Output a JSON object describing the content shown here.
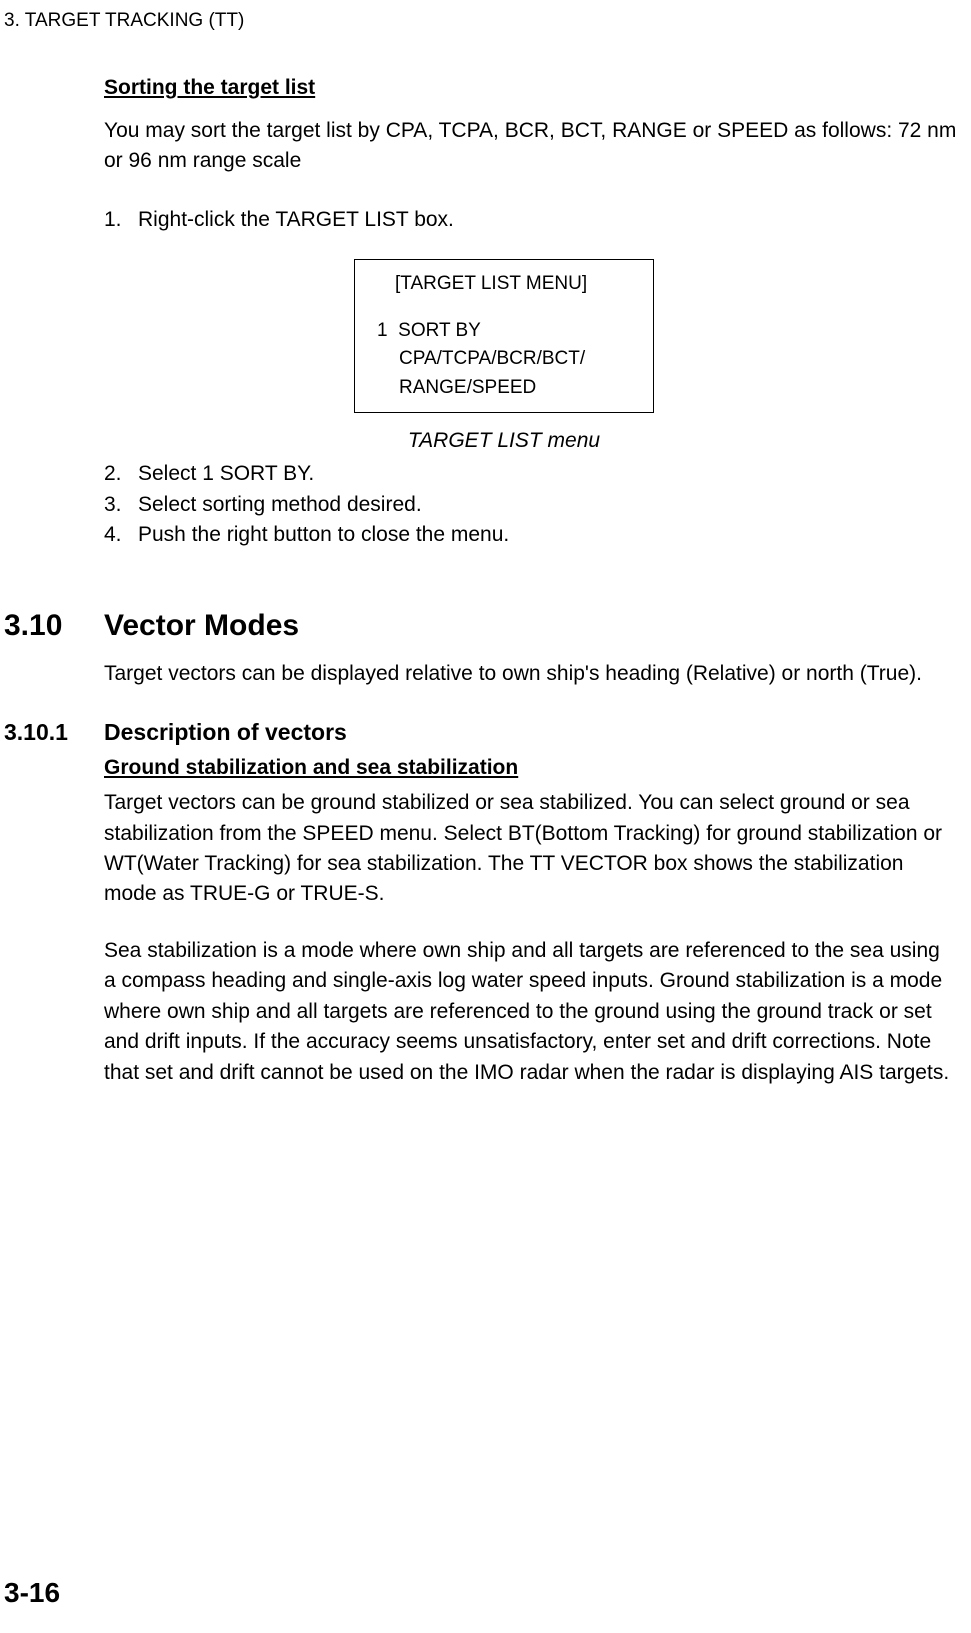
{
  "runningHeader": "3. TARGET TRACKING (TT)",
  "sorting": {
    "heading": "Sorting the target list",
    "intro": "You may sort the target list by CPA, TCPA, BCR, BCT, RANGE or SPEED as follows: 72 nm or 96 nm range scale",
    "steps": {
      "n1": "1.",
      "t1": "Right-click the TARGET LIST box.",
      "n2": "2.",
      "t2": "Select 1 SORT BY.",
      "n3": "3.",
      "t3": "Select sorting method desired.",
      "n4": "4.",
      "t4": "Push the right button to close the menu."
    },
    "menuBox": {
      "title": "[TARGET LIST MENU]",
      "item1Num": "1",
      "item1Label": "SORT BY",
      "item1Sub1": "CPA/TCPA/BCR/BCT/",
      "item1Sub2": "RANGE/SPEED"
    },
    "menuCaption": "TARGET LIST menu"
  },
  "section310": {
    "num": "3.10",
    "title": "Vector Modes",
    "intro": "Target vectors can be displayed relative to own ship's heading (Relative) or north (True)."
  },
  "section3101": {
    "num": "3.10.1",
    "title": "Description of vectors",
    "subHeading": "Ground stabilization and sea stabilization",
    "para1": "Target vectors can be ground stabilized or sea stabilized. You can select ground or sea stabilization from the SPEED menu. Select BT(Bottom Tracking) for ground stabilization or WT(Water Tracking) for sea stabilization. The TT VECTOR box shows the stabilization mode as TRUE-G or TRUE-S.",
    "para2": "Sea stabilization is a mode where own ship and all targets are referenced to the sea using a compass heading and single-axis log water speed inputs. Ground stabilization is a mode where own ship and all targets are referenced to the ground using the ground track or set and drift inputs. If the accuracy seems unsatisfactory, enter set and drift corrections. Note that set and drift cannot be used on the IMO radar when the radar is displaying AIS targets."
  },
  "pageNumber": "3-16"
}
